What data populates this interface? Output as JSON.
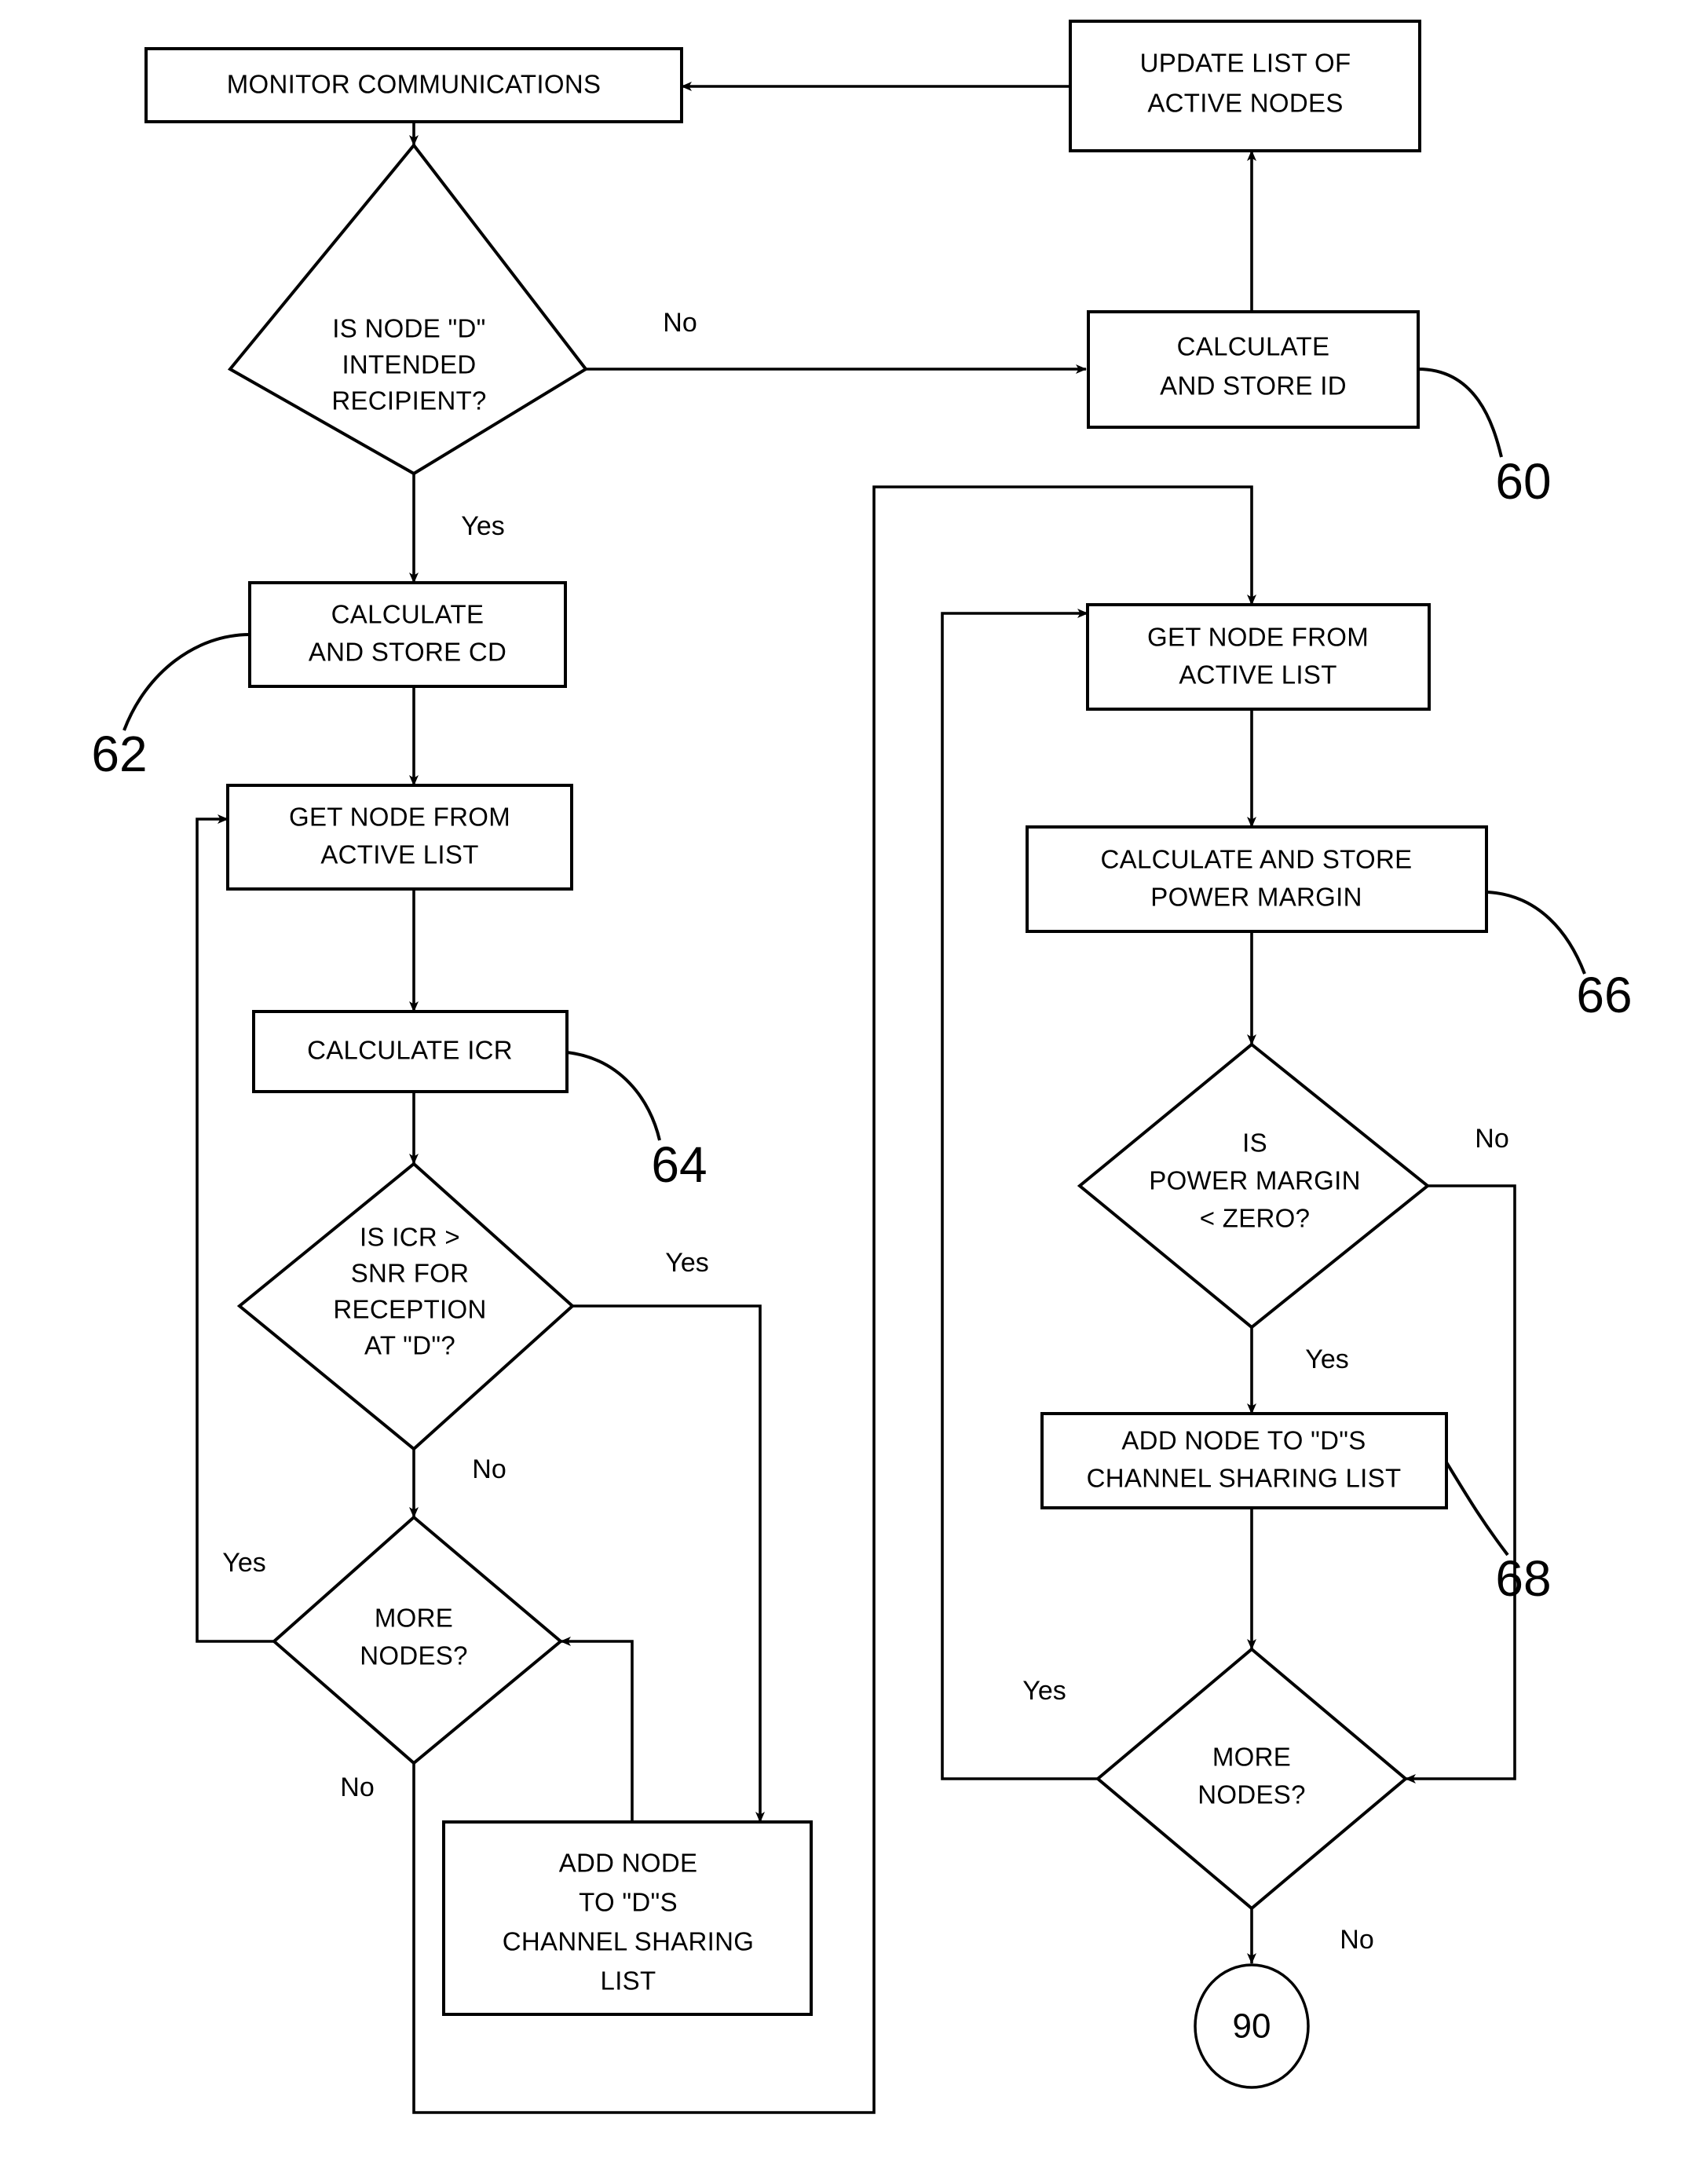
{
  "figure": {
    "type": "flowchart",
    "title": "",
    "background_color": "#ffffff",
    "line_color": "#000000"
  },
  "nodes": {
    "monitor_communications": {
      "shape": "process",
      "lines": [
        "MONITOR COMMUNICATIONS"
      ]
    },
    "update_list_of_active_nodes": {
      "shape": "process",
      "lines": [
        "UPDATE LIST OF",
        "ACTIVE  NODES"
      ]
    },
    "is_node_d_intended_recipient": {
      "shape": "decision",
      "lines": [
        "IS NODE \"D\"",
        "INTENDED",
        "RECIPIENT?"
      ]
    },
    "calculate_and_store_id": {
      "shape": "process",
      "lines": [
        "CALCULATE",
        "AND STORE ID"
      ]
    },
    "calculate_and_store_cd": {
      "shape": "process",
      "lines": [
        "CALCULATE",
        "AND STORE CD"
      ]
    },
    "get_node_from_active_list_left": {
      "shape": "process",
      "lines": [
        "GET NODE FROM",
        "ACTIVE LIST"
      ]
    },
    "calculate_icr": {
      "shape": "process",
      "lines": [
        "CALCULATE ICR"
      ]
    },
    "is_icr_gt_snr": {
      "shape": "decision",
      "lines": [
        "IS ICR >",
        "SNR FOR",
        "RECEPTION",
        "AT \"D\"?"
      ]
    },
    "more_nodes_left": {
      "shape": "decision",
      "lines": [
        "MORE",
        "NODES?"
      ]
    },
    "add_node_left": {
      "shape": "process",
      "lines": [
        "ADD NODE",
        "TO \"D\"S",
        "CHANNEL SHARING",
        "LIST"
      ]
    },
    "get_node_from_active_list_right": {
      "shape": "process",
      "lines": [
        "GET NODE FROM",
        "ACTIVE LIST"
      ]
    },
    "calculate_and_store_power_margin": {
      "shape": "process",
      "lines": [
        "CALCULATE AND STORE",
        "POWER MARGIN"
      ]
    },
    "is_power_margin_lt_zero": {
      "shape": "decision",
      "lines": [
        "IS",
        "POWER MARGIN",
        "< ZERO?"
      ]
    },
    "add_node_right": {
      "shape": "process",
      "lines": [
        "ADD NODE TO \"D\"S",
        "CHANNEL SHARING LIST"
      ]
    },
    "more_nodes_right": {
      "shape": "decision",
      "lines": [
        "MORE",
        "NODES?"
      ]
    },
    "connector_90": {
      "shape": "circle",
      "lines": [
        "90"
      ]
    }
  },
  "edge_labels": {
    "decision_recipient_no": "No",
    "decision_recipient_yes": "Yes",
    "icr_yes": "Yes",
    "icr_no": "No",
    "more_nodes_left_yes": "Yes",
    "more_nodes_left_no": "No",
    "power_margin_no": "No",
    "power_margin_yes": "Yes",
    "more_nodes_right_yes": "Yes",
    "more_nodes_right_no": "No"
  },
  "reference_numerals": {
    "ref_60": "60",
    "ref_62": "62",
    "ref_64": "64",
    "ref_66": "66",
    "ref_68": "68"
  }
}
